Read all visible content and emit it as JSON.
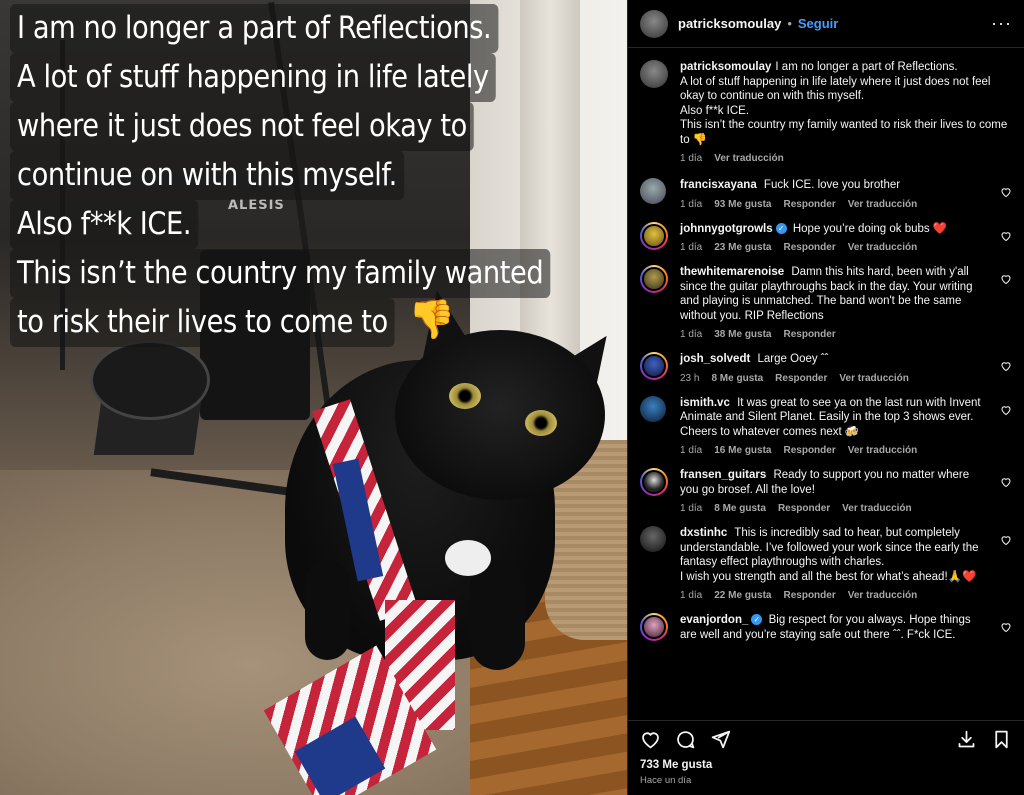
{
  "story": {
    "lines": [
      "I am no longer a part of Reflections.",
      "A lot of stuff happening in life lately",
      "where it just does not feel okay to",
      "continue on with this myself.",
      "Also f**k ICE.",
      "This isn’t the country my family wanted",
      "to risk their lives to come to"
    ],
    "emoji": "👎",
    "amp_brand": "ALESIS"
  },
  "header": {
    "username": "patricksomoulay",
    "separator": "•",
    "follow_label": "Seguir",
    "more": "···"
  },
  "caption": {
    "username": "patricksomoulay",
    "lines": [
      "I am no longer a part of Reflections.",
      "A lot of stuff happening in life lately where it just does not feel okay to continue on with this myself.",
      "Also f**k ICE.",
      "This isn’t the country my family wanted to risk their lives to come to 👎"
    ],
    "time": "1 día",
    "translate": "Ver traducción"
  },
  "comments": [
    {
      "username": "francisxayana",
      "verified": false,
      "text": "Fuck ICE. love you brother",
      "time": "1 día",
      "likes": "93 Me gusta",
      "reply": "Responder",
      "translate": "Ver traducción",
      "avatar_color": "#6b6f6a"
    },
    {
      "username": "johnnygotgrowls",
      "verified": true,
      "text": "Hope you’re doing ok bubs ❤️",
      "time": "1 día",
      "likes": "23 Me gusta",
      "reply": "Responder",
      "translate": "Ver traducción",
      "avatar_color": "#c9a227"
    },
    {
      "username": "thewhitemarenoise",
      "verified": false,
      "text": "Damn this hits hard, been with y'all since the guitar playthroughs back in the day. Your writing and playing is unmatched. The band won't be the same without you. RIP Reflections",
      "time": "1 día",
      "likes": "38 Me gusta",
      "reply": "Responder",
      "translate": "",
      "avatar_color": "#8a7a3a"
    },
    {
      "username": "josh_solvedt",
      "verified": false,
      "text": "Large Ooey ˆˆ",
      "time": "23 h",
      "likes": "8 Me gusta",
      "reply": "Responder",
      "translate": "Ver traducción",
      "avatar_color": "#2b3f8a"
    },
    {
      "username": "ismith.vc",
      "verified": false,
      "text": "It was great to see ya on the last run with Invent Animate and Silent Planet. Easily in the top 3 shows ever. Cheers to whatever comes next 🍻",
      "time": "1 día",
      "likes": "16 Me gusta",
      "reply": "Responder",
      "translate": "Ver traducción",
      "avatar_color": "#1f4f7a"
    },
    {
      "username": "fransen_guitars",
      "verified": false,
      "text": "Ready to support you no matter where you go brosef. All the love!",
      "time": "1 día",
      "likes": "8 Me gusta",
      "reply": "Responder",
      "translate": "Ver traducción",
      "avatar_color": "#2a2a2a"
    },
    {
      "username": "dxstinhc",
      "verified": false,
      "text": "This is incredibly sad to hear, but completely understandable. I’ve followed your work since the early the fantasy effect playthroughs with charles.",
      "text2": "I wish you strength and all the best for what’s ahead!🙏❤️",
      "time": "1 día",
      "likes": "22 Me gusta",
      "reply": "Responder",
      "translate": "Ver traducción",
      "avatar_color": "#3a3a3a"
    },
    {
      "username": "evanjordon_",
      "verified": true,
      "text": "Big respect for you always. Hope things are well and you’re staying safe out there ˆˆ. F*ck ICE.",
      "time": "",
      "likes": "",
      "reply": "",
      "translate": "",
      "avatar_color": "#b07a9a"
    }
  ],
  "footer": {
    "likes": "733 Me gusta",
    "time": "Hace un día"
  },
  "colors": {
    "background": "#000000",
    "text": "#f5f5f5",
    "muted": "#a8a8a8",
    "link": "#4a9dff",
    "verified": "#3897f0"
  }
}
